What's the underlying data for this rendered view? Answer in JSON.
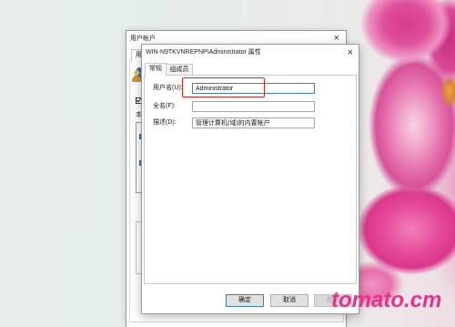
{
  "theme": {
    "highlight": "#e2231a",
    "watermark": "#e8318a",
    "focus_border": "#3d7fbf"
  },
  "watermark": "tomato.cm",
  "back_window": {
    "title": "用户帐户",
    "close_glyph": "×",
    "tab_label": "用户",
    "checkbox_checked": true,
    "partial_label": "本",
    "icon": "users-icon"
  },
  "dialog": {
    "title": "WIN-N9TKVNREPNP\\Administrator 属性",
    "close_glyph": "×",
    "tabs": [
      {
        "label": "常规",
        "selected": true
      },
      {
        "label": "组成员",
        "selected": false
      }
    ],
    "fields": {
      "username": {
        "label": "用户名(U):",
        "value": "Administrator"
      },
      "fullname": {
        "label": "全名(F):",
        "value": ""
      },
      "description": {
        "label": "描述(D):",
        "value": "管理计算机(域)的内置帐户"
      }
    },
    "buttons": {
      "ok": "确定",
      "cancel": "取消",
      "apply": "应用",
      "apply_enabled": false
    }
  }
}
